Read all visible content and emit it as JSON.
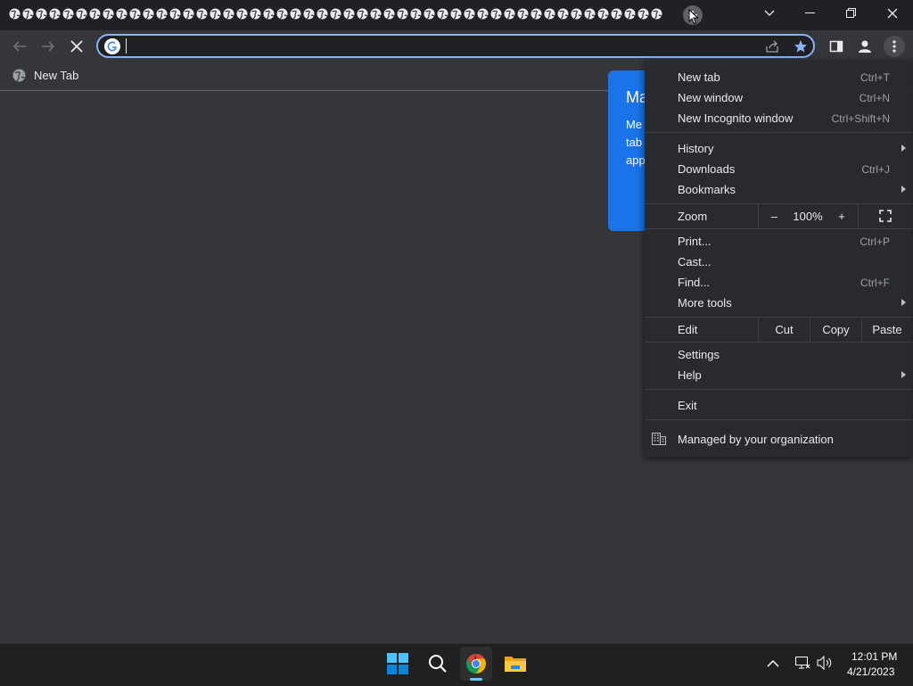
{
  "browser": {
    "tab_count": 49,
    "tab_icon": "globe-icon",
    "new_tab_icon": "plus-icon",
    "window_controls": [
      "chevron-down-icon",
      "minimize-icon",
      "restore-icon",
      "close-icon"
    ]
  },
  "toolbar": {
    "back_icon": "back-arrow-icon",
    "forward_icon": "forward-arrow-icon",
    "stop_icon": "close-stop-icon",
    "omnibox_value": "",
    "right_icons": [
      "share-icon",
      "star-icon",
      "side-panel-icon",
      "profile-icon",
      "kebab-menu-icon"
    ]
  },
  "bookmarks_bar": {
    "label": "New Tab"
  },
  "promo": {
    "title": "Ma",
    "lines": [
      "Me",
      "tab",
      "app"
    ]
  },
  "menu": {
    "new_tab": {
      "label": "New tab",
      "shortcut": "Ctrl+T"
    },
    "new_window": {
      "label": "New window",
      "shortcut": "Ctrl+N"
    },
    "incognito": {
      "label": "New Incognito window",
      "shortcut": "Ctrl+Shift+N"
    },
    "history": {
      "label": "History"
    },
    "downloads": {
      "label": "Downloads",
      "shortcut": "Ctrl+J"
    },
    "bookmarks": {
      "label": "Bookmarks"
    },
    "zoom": {
      "label": "Zoom",
      "minus": "–",
      "value": "100%",
      "plus": "+"
    },
    "print": {
      "label": "Print...",
      "shortcut": "Ctrl+P"
    },
    "cast": {
      "label": "Cast..."
    },
    "find": {
      "label": "Find...",
      "shortcut": "Ctrl+F"
    },
    "more_tools": {
      "label": "More tools"
    },
    "edit": {
      "label": "Edit",
      "cut": "Cut",
      "copy": "Copy",
      "paste": "Paste"
    },
    "settings": {
      "label": "Settings"
    },
    "help": {
      "label": "Help"
    },
    "exit": {
      "label": "Exit"
    },
    "managed": {
      "label": "Managed by your organization"
    }
  },
  "taskbar": {
    "apps": [
      "windows-start-icon",
      "search-icon",
      "chrome-icon",
      "file-explorer-icon"
    ],
    "time": "12:01 PM",
    "date": "4/21/2023"
  },
  "colors": {
    "accent": "#8ab4f8",
    "promo_blue": "#1a73e8",
    "frame": "#202124",
    "toolbar": "#35363a",
    "menu": "#292a2d"
  }
}
